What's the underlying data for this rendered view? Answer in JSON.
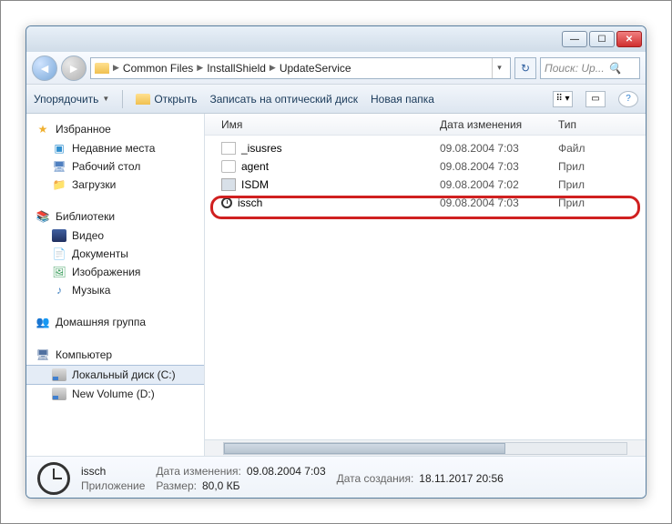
{
  "breadcrumb": [
    "Common Files",
    "InstallShield",
    "UpdateService"
  ],
  "search_placeholder": "Поиск: Up...",
  "toolbar": {
    "organize": "Упорядочить",
    "open": "Открыть",
    "burn": "Записать на оптический диск",
    "new_folder": "Новая папка"
  },
  "columns": {
    "name": "Имя",
    "modified": "Дата изменения",
    "type": "Тип"
  },
  "tree": {
    "favorites": "Избранное",
    "recent": "Недавние места",
    "desktop": "Рабочий стол",
    "downloads": "Загрузки",
    "libraries": "Библиотеки",
    "videos": "Видео",
    "documents": "Документы",
    "pictures": "Изображения",
    "music": "Музыка",
    "homegroup": "Домашняя группа",
    "computer": "Компьютер",
    "disk_c": "Локальный диск (C:)",
    "disk_d": "New Volume (D:)"
  },
  "files": [
    {
      "name": "_isusres",
      "date": "09.08.2004 7:03",
      "type": "Файл",
      "icon": "page"
    },
    {
      "name": "agent",
      "date": "09.08.2004 7:03",
      "type": "Прил",
      "icon": "agent"
    },
    {
      "name": "ISDM",
      "date": "09.08.2004 7:02",
      "type": "Прил",
      "icon": "app"
    },
    {
      "name": "issch",
      "date": "09.08.2004 7:03",
      "type": "Прил",
      "icon": "clock"
    }
  ],
  "details": {
    "name": "issch",
    "kind": "Приложение",
    "modified_label": "Дата изменения:",
    "modified": "09.08.2004 7:03",
    "size_label": "Размер:",
    "size": "80,0 КБ",
    "created_label": "Дата создания:",
    "created": "18.11.2017 20:56"
  }
}
